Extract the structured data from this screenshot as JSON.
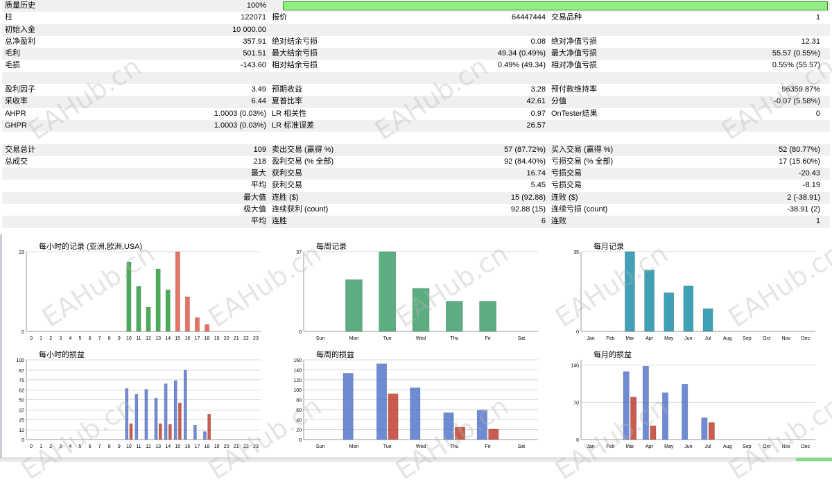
{
  "stats_rows": [
    [
      "质量历史",
      "100%",
      "",
      "",
      "",
      ""
    ],
    [
      "柱",
      "122071",
      "报价",
      "64447444",
      "交易品种",
      "1"
    ],
    [
      "初始入金",
      "10 000.00",
      "",
      "",
      "",
      ""
    ],
    [
      "总净盈利",
      "357.91",
      "绝对结余亏损",
      "0.08",
      "绝对净值亏损",
      "12.31"
    ],
    [
      "毛利",
      "501.51",
      "最大结余亏损",
      "49.34 (0.49%)",
      "最大净值亏损",
      "55.57 (0.55%)"
    ],
    [
      "毛损",
      "-143.60",
      "相对结余亏损",
      "0.49% (49.34)",
      "相对净值亏损",
      "0.55% (55.57)"
    ],
    [
      "",
      "",
      "",
      "",
      "",
      ""
    ],
    [
      "盈利因子",
      "3.49",
      "预期收益",
      "3.28",
      "预付款维持率",
      "96359.87%"
    ],
    [
      "采收率",
      "6.44",
      "夏普比率",
      "42.61",
      "分值",
      "-0.07 (5.58%)"
    ],
    [
      "AHPR",
      "1.0003 (0.03%)",
      "LR 相关性",
      "0.97",
      "OnTester结果",
      "0"
    ],
    [
      "GHPR",
      "1.0003 (0.03%)",
      "LR 标准误差",
      "26.57",
      "",
      ""
    ],
    [
      "",
      "",
      "",
      "",
      "",
      ""
    ],
    [
      "交易总计",
      "109",
      "卖出交易 (赢得 %)",
      "57 (87.72%)",
      "买入交易 (赢得 %)",
      "52 (80.77%)"
    ],
    [
      "总成交",
      "218",
      "盈利交易 (% 全部)",
      "92 (84.40%)",
      "亏损交易 (% 全部)",
      "17 (15.60%)"
    ],
    [
      "",
      "最大",
      "获利交易",
      "16.74",
      "亏损交易",
      "-20.43"
    ],
    [
      "",
      "平均",
      "获利交易",
      "5.45",
      "亏损交易",
      "-8.19"
    ],
    [
      "",
      "最大值",
      "连胜 ($)",
      "15 (92.88)",
      "连败 ($)",
      "2 (-38.91)"
    ],
    [
      "",
      "极大值",
      "连续获利 (count)",
      "92.88 (15)",
      "连续亏损 (count)",
      "-38.91 (2)"
    ],
    [
      "",
      "平均",
      "连胜",
      "6",
      "连败",
      "1"
    ],
    [
      "",
      "",
      "",
      "",
      "",
      ""
    ]
  ],
  "colors": {
    "buy_green": "#2e9e3e",
    "sell_red": "#e05a4a",
    "week_green": "#3f9f6a",
    "month_teal": "#1e8fa8",
    "profit_blue": "#5577cc",
    "loss_red": "#c04030",
    "quality_bar": "#8fef7f"
  },
  "watermark": "EAHub.cn",
  "chart_data": [
    {
      "type": "bar",
      "title": "每小时的记录 (亚洲,欧洲,USA)",
      "categories": [
        "0",
        "1",
        "2",
        "3",
        "4",
        "5",
        "6",
        "7",
        "8",
        "9",
        "10",
        "11",
        "12",
        "13",
        "14",
        "15",
        "16",
        "17",
        "18",
        "19",
        "20",
        "21",
        "22",
        "23"
      ],
      "series": [
        {
          "values": [
            0,
            0,
            0,
            0,
            0,
            0,
            0,
            0,
            0,
            0,
            20,
            13,
            7,
            18,
            12,
            0,
            0,
            0,
            0,
            0,
            0,
            0,
            0,
            0
          ]
        },
        {
          "values": [
            0,
            0,
            0,
            0,
            0,
            0,
            0,
            0,
            0,
            0,
            0,
            0,
            0,
            0,
            0,
            23,
            10,
            4,
            2,
            0,
            0,
            0,
            0,
            0
          ]
        }
      ],
      "yticks": [
        "0",
        "23"
      ],
      "ylim": [
        0,
        23
      ]
    },
    {
      "type": "bar",
      "title": "每周记录",
      "categories": [
        "Sun",
        "Mon",
        "Tue",
        "Wed",
        "Thu",
        "Fri",
        "Sat"
      ],
      "series": [
        {
          "values": [
            0,
            24,
            37,
            20,
            14,
            14,
            0
          ]
        }
      ],
      "yticks": [
        "0",
        "37"
      ],
      "ylim": [
        0,
        37
      ]
    },
    {
      "type": "bar",
      "title": "每月记录",
      "categories": [
        "Jan",
        "Feb",
        "Mar",
        "Apr",
        "May",
        "Jun",
        "Jul",
        "Aug",
        "Sep",
        "Oct",
        "Nov",
        "Dec"
      ],
      "series": [
        {
          "values": [
            0,
            0,
            35,
            27,
            17,
            20,
            10,
            0,
            0,
            0,
            0,
            0
          ]
        }
      ],
      "yticks": [
        "0",
        "35"
      ],
      "ylim": [
        0,
        35
      ]
    },
    {
      "type": "bar",
      "title": "每小时的损益",
      "categories": [
        "0",
        "1",
        "2",
        "3",
        "4",
        "5",
        "6",
        "7",
        "8",
        "9",
        "10",
        "11",
        "12",
        "13",
        "14",
        "15",
        "16",
        "17",
        "18",
        "19",
        "20",
        "21",
        "22",
        "23"
      ],
      "series": [
        {
          "values": [
            0,
            0,
            0,
            0,
            0,
            0,
            0,
            0,
            0,
            0,
            64,
            57,
            63,
            52,
            70,
            74,
            87,
            18,
            10,
            0,
            0,
            0,
            0,
            0
          ]
        },
        {
          "values": [
            0,
            0,
            0,
            0,
            0,
            0,
            0,
            0,
            0,
            0,
            20,
            0,
            0,
            20,
            19,
            46,
            0,
            0,
            32,
            0,
            0,
            0,
            0,
            0
          ]
        }
      ],
      "yticks": [
        "0",
        "12",
        "25",
        "37",
        "50",
        "62",
        "75",
        "87",
        "100"
      ],
      "ylim": [
        0,
        100
      ]
    },
    {
      "type": "bar",
      "title": "每周的损益",
      "categories": [
        "Sun",
        "Mon",
        "Tue",
        "Wed",
        "Thu",
        "Fri",
        "Sat"
      ],
      "series": [
        {
          "values": [
            0,
            133,
            152,
            104,
            54,
            59,
            0
          ]
        },
        {
          "values": [
            0,
            0,
            92,
            0,
            25,
            21,
            0
          ]
        }
      ],
      "yticks": [
        "0",
        "20",
        "40",
        "60",
        "80",
        "100",
        "120",
        "140",
        "160"
      ],
      "ylim": [
        0,
        160
      ]
    },
    {
      "type": "bar",
      "title": "每月的损益",
      "categories": [
        "Jan",
        "Feb",
        "Mar",
        "Apr",
        "May",
        "Jun",
        "Jul",
        "Aug",
        "Sep",
        "Oct",
        "Nov",
        "Dec"
      ],
      "series": [
        {
          "values": [
            0,
            0,
            128,
            138,
            88,
            104,
            41,
            0,
            0,
            0,
            0,
            0
          ]
        },
        {
          "values": [
            0,
            0,
            80,
            26,
            0,
            0,
            32,
            0,
            0,
            0,
            0,
            0
          ]
        }
      ],
      "yticks": [
        "0",
        "70",
        "140"
      ],
      "ylim": [
        0,
        150
      ]
    }
  ]
}
